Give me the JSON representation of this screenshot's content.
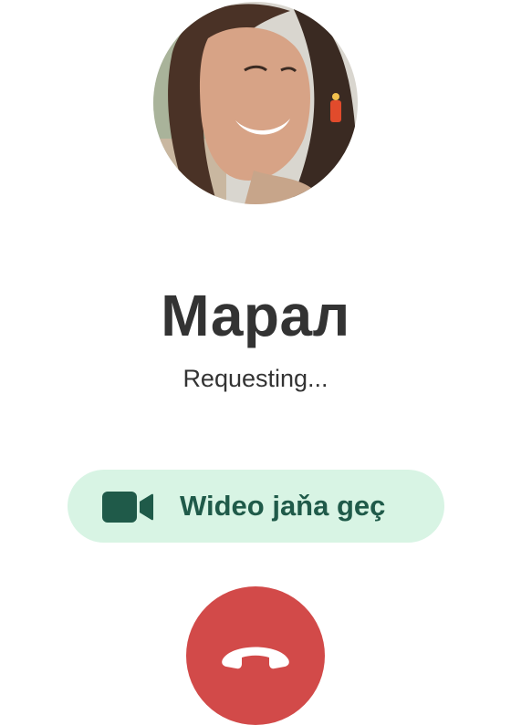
{
  "contact": {
    "name": "Марал",
    "status": "Requesting..."
  },
  "actions": {
    "video_switch_label": "Wideo jaňa geç",
    "video_icon": "video-camera-icon",
    "end_call_icon": "phone-hangup-icon"
  },
  "colors": {
    "background": "#ffffff",
    "text": "#333333",
    "video_button_bg": "#d8f4e4",
    "video_button_fg": "#1f5a49",
    "end_call_bg": "#d24a49",
    "end_call_fg": "#ffffff"
  }
}
